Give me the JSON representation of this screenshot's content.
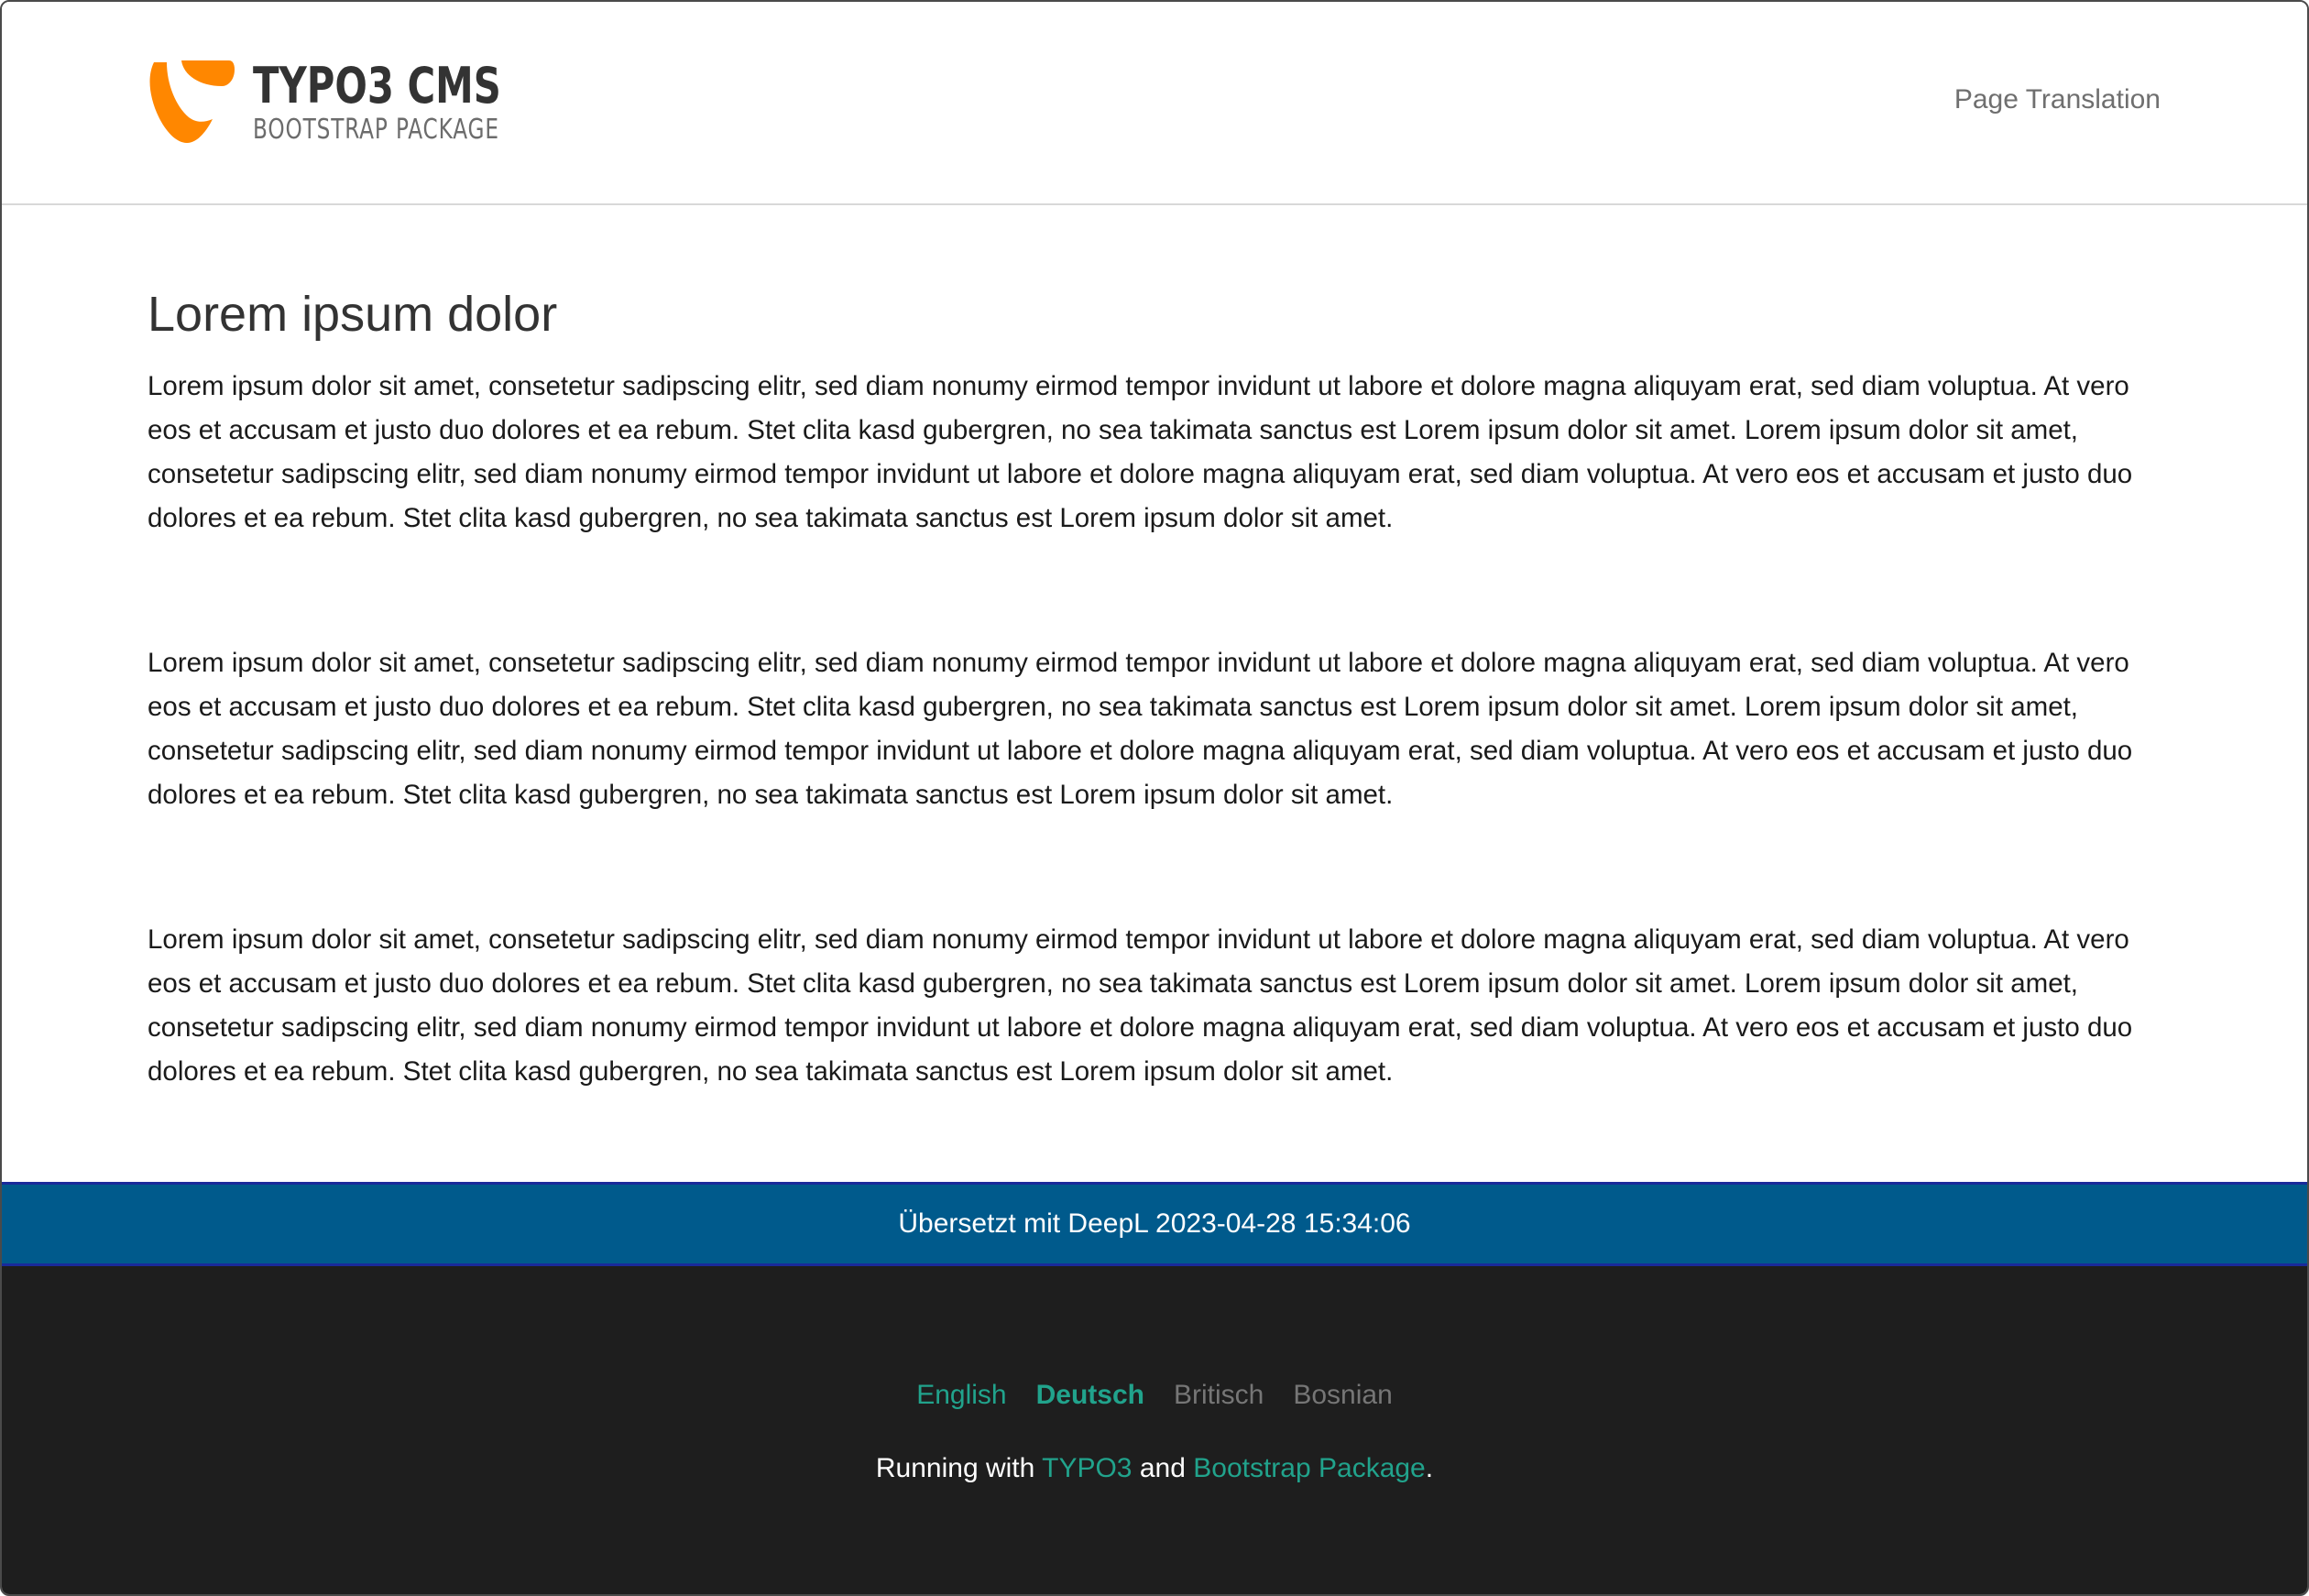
{
  "header": {
    "logo_title": "TYPO3 CMS",
    "logo_subtitle": "BOOTSTRAP PACKAGE",
    "nav_link": "Page Translation",
    "logo_color": "#ff8700"
  },
  "main": {
    "title": "Lorem ipsum dolor",
    "paragraphs": [
      "Lorem ipsum dolor sit amet, consetetur sadipscing elitr, sed diam nonumy eirmod tempor invidunt ut labore et dolore magna aliquyam erat, sed diam voluptua. At vero eos et accusam et justo duo dolores et ea rebum. Stet clita kasd gubergren, no sea takimata sanctus est Lorem ipsum dolor sit amet. Lorem ipsum dolor sit amet, consetetur sadipscing elitr, sed diam nonumy eirmod tempor invidunt ut labore et dolore magna aliquyam erat, sed diam voluptua. At vero eos et accusam et justo duo dolores et ea rebum. Stet clita kasd gubergren, no sea takimata sanctus est Lorem ipsum dolor sit amet.",
      "Lorem ipsum dolor sit amet, consetetur sadipscing elitr, sed diam nonumy eirmod tempor invidunt ut labore et dolore magna aliquyam erat, sed diam voluptua. At vero eos et accusam et justo duo dolores et ea rebum. Stet clita kasd gubergren, no sea takimata sanctus est Lorem ipsum dolor sit amet. Lorem ipsum dolor sit amet, consetetur sadipscing elitr, sed diam nonumy eirmod tempor invidunt ut labore et dolore magna aliquyam erat, sed diam voluptua. At vero eos et accusam et justo duo dolores et ea rebum. Stet clita kasd gubergren, no sea takimata sanctus est Lorem ipsum dolor sit amet.",
      "Lorem ipsum dolor sit amet, consetetur sadipscing elitr, sed diam nonumy eirmod tempor invidunt ut labore et dolore magna aliquyam erat, sed diam voluptua. At vero eos et accusam et justo duo dolores et ea rebum. Stet clita kasd gubergren, no sea takimata sanctus est Lorem ipsum dolor sit amet. Lorem ipsum dolor sit amet, consetetur sadipscing elitr, sed diam nonumy eirmod tempor invidunt ut labore et dolore magna aliquyam erat, sed diam voluptua. At vero eos et accusam et justo duo dolores et ea rebum. Stet clita kasd gubergren, no sea takimata sanctus est Lorem ipsum dolor sit amet."
    ]
  },
  "translation_notice": {
    "text": "Übersetzt mit DeepL 2023-04-28 15:34:06",
    "bg_color": "#005a8c"
  },
  "footer": {
    "languages": [
      {
        "label": "English",
        "state": "link"
      },
      {
        "label": "Deutsch",
        "state": "active"
      },
      {
        "label": "Britisch",
        "state": "unavailable"
      },
      {
        "label": "Bosnian",
        "state": "unavailable"
      }
    ],
    "credits": {
      "prefix": "Running with",
      "typo3_link": "TYPO3",
      "conjunction": "and",
      "bootstrap_link": "Bootstrap Package",
      "suffix": "."
    },
    "accent_color": "#21a38c",
    "bg_color": "#1e1e1e"
  }
}
